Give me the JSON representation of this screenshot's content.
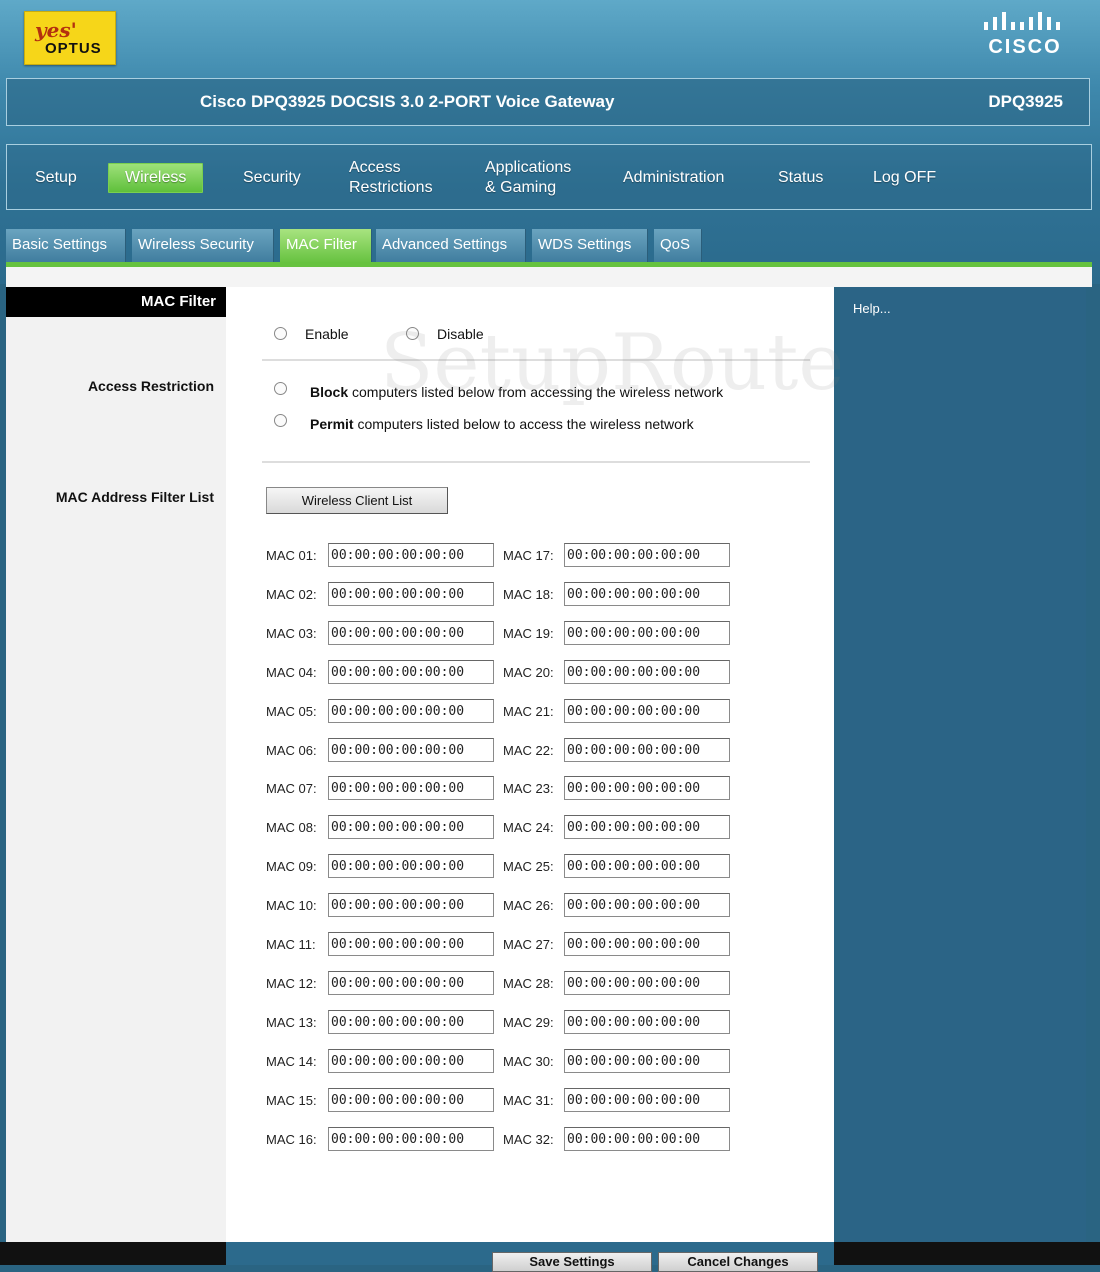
{
  "brand": {
    "isp_logo_top": "yes'",
    "isp_logo_bottom": "OPTUS",
    "vendor_logo": "CISCO"
  },
  "titlebar": {
    "title": "Cisco DPQ3925 DOCSIS 3.0 2-PORT Voice Gateway",
    "model": "DPQ3925"
  },
  "main_nav": [
    {
      "label": "Setup"
    },
    {
      "label": "Wireless",
      "active": true
    },
    {
      "label": "Security"
    },
    {
      "label": "Access Restrictions"
    },
    {
      "label": "Applications & Gaming"
    },
    {
      "label": "Administration"
    },
    {
      "label": "Status"
    },
    {
      "label": "Log OFF"
    }
  ],
  "sub_nav": [
    {
      "label": "Basic Settings"
    },
    {
      "label": "Wireless Security"
    },
    {
      "label": "MAC Filter",
      "active": true
    },
    {
      "label": "Advanced Settings"
    },
    {
      "label": "WDS Settings"
    },
    {
      "label": "QoS"
    }
  ],
  "section_title": "MAC Filter",
  "left_labels": {
    "access_restriction": "Access Restriction",
    "mac_filter_list": "MAC Address Filter List"
  },
  "enable_option": "Enable",
  "disable_option": "Disable",
  "restriction_block_bold": "Block",
  "restriction_block_text": " computers listed below from accessing the wireless network",
  "restriction_permit_bold": "Permit",
  "restriction_permit_text": " computers listed below to access the wireless network",
  "client_list_button": "Wireless Client List",
  "help_link": "Help...",
  "watermark": "SetupRouter.com",
  "mac_entries_left": [
    {
      "label": "MAC 01:",
      "value": "00:00:00:00:00:00"
    },
    {
      "label": "MAC 02:",
      "value": "00:00:00:00:00:00"
    },
    {
      "label": "MAC 03:",
      "value": "00:00:00:00:00:00"
    },
    {
      "label": "MAC 04:",
      "value": "00:00:00:00:00:00"
    },
    {
      "label": "MAC 05:",
      "value": "00:00:00:00:00:00"
    },
    {
      "label": "MAC 06:",
      "value": "00:00:00:00:00:00"
    },
    {
      "label": "MAC 07:",
      "value": "00:00:00:00:00:00"
    },
    {
      "label": "MAC 08:",
      "value": "00:00:00:00:00:00"
    },
    {
      "label": "MAC 09:",
      "value": "00:00:00:00:00:00"
    },
    {
      "label": "MAC 10:",
      "value": "00:00:00:00:00:00"
    },
    {
      "label": "MAC 11:",
      "value": "00:00:00:00:00:00"
    },
    {
      "label": "MAC 12:",
      "value": "00:00:00:00:00:00"
    },
    {
      "label": "MAC 13:",
      "value": "00:00:00:00:00:00"
    },
    {
      "label": "MAC 14:",
      "value": "00:00:00:00:00:00"
    },
    {
      "label": "MAC 15:",
      "value": "00:00:00:00:00:00"
    },
    {
      "label": "MAC 16:",
      "value": "00:00:00:00:00:00"
    }
  ],
  "mac_entries_right": [
    {
      "label": "MAC 17:",
      "value": "00:00:00:00:00:00"
    },
    {
      "label": "MAC 18:",
      "value": "00:00:00:00:00:00"
    },
    {
      "label": "MAC 19:",
      "value": "00:00:00:00:00:00"
    },
    {
      "label": "MAC 20:",
      "value": "00:00:00:00:00:00"
    },
    {
      "label": "MAC 21:",
      "value": "00:00:00:00:00:00"
    },
    {
      "label": "MAC 22:",
      "value": "00:00:00:00:00:00"
    },
    {
      "label": "MAC 23:",
      "value": "00:00:00:00:00:00"
    },
    {
      "label": "MAC 24:",
      "value": "00:00:00:00:00:00"
    },
    {
      "label": "MAC 25:",
      "value": "00:00:00:00:00:00"
    },
    {
      "label": "MAC 26:",
      "value": "00:00:00:00:00:00"
    },
    {
      "label": "MAC 27:",
      "value": "00:00:00:00:00:00"
    },
    {
      "label": "MAC 28:",
      "value": "00:00:00:00:00:00"
    },
    {
      "label": "MAC 29:",
      "value": "00:00:00:00:00:00"
    },
    {
      "label": "MAC 30:",
      "value": "00:00:00:00:00:00"
    },
    {
      "label": "MAC 31:",
      "value": "00:00:00:00:00:00"
    },
    {
      "label": "MAC 32:",
      "value": "00:00:00:00:00:00"
    }
  ],
  "footer": {
    "save": "Save Settings",
    "cancel": "Cancel Changes"
  },
  "colors": {
    "background": "#2a6482",
    "accent_green": "#66c23f",
    "help_panel": "#2b6486"
  }
}
